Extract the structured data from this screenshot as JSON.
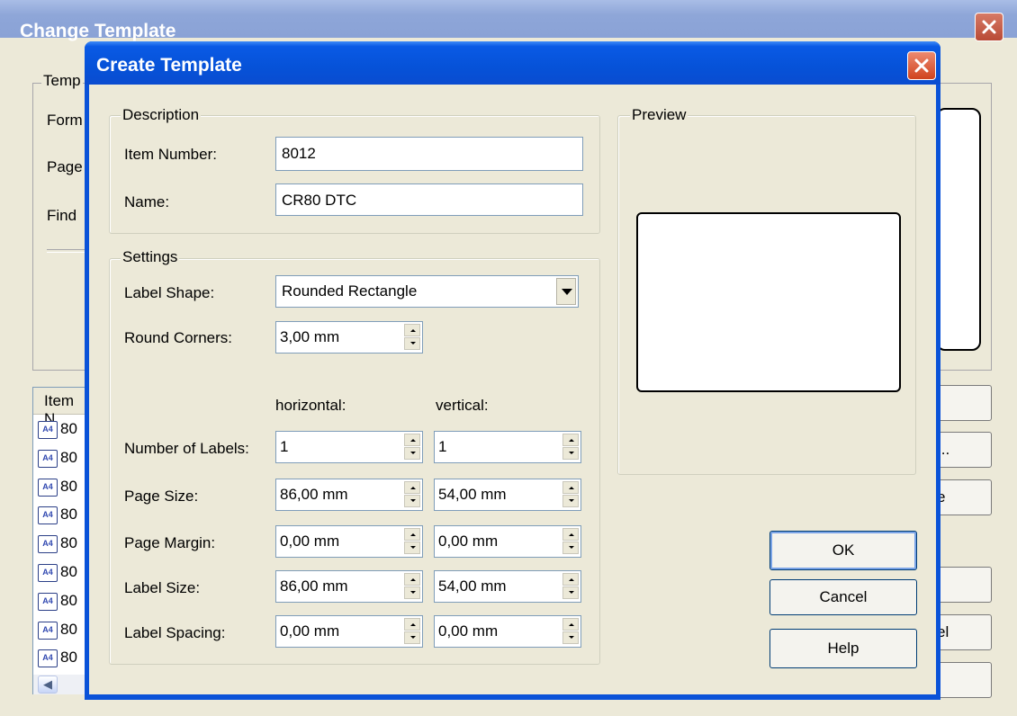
{
  "back_window": {
    "title": "Change Template",
    "group_caption": "Temp",
    "labels": [
      "Form",
      "Page",
      "Find"
    ],
    "list_header": "Item N",
    "list_rows": [
      {
        "icon": "A4",
        "text": "80"
      },
      {
        "icon": "A4",
        "text": "80"
      },
      {
        "icon": "A4",
        "text": "80"
      },
      {
        "icon": "A4",
        "text": "80"
      },
      {
        "icon": "A4",
        "text": "80"
      },
      {
        "icon": "A4",
        "text": "80"
      },
      {
        "icon": "A4",
        "text": "80"
      },
      {
        "icon": "A4",
        "text": "80"
      },
      {
        "icon": "A4",
        "text": "80"
      }
    ],
    "right_buttons": [
      "",
      "...",
      "e",
      "",
      "el",
      ""
    ]
  },
  "dialog": {
    "title": "Create Template",
    "description": {
      "caption": "Description",
      "item_number_label": "Item Number:",
      "item_number_value": "8012",
      "name_label": "Name:",
      "name_value": "CR80 DTC"
    },
    "settings": {
      "caption": "Settings",
      "label_shape_label": "Label Shape:",
      "label_shape_value": "Rounded Rectangle",
      "round_corners_label": "Round Corners:",
      "round_corners_value": "3,00 mm",
      "col_horizontal": "horizontal:",
      "col_vertical": "vertical:",
      "rows": [
        {
          "label": "Number of Labels:",
          "h": "1",
          "v": "1"
        },
        {
          "label": "Page Size:",
          "h": "86,00 mm",
          "v": "54,00 mm"
        },
        {
          "label": "Page Margin:",
          "h": "0,00 mm",
          "v": "0,00 mm"
        },
        {
          "label": "Label Size:",
          "h": "86,00 mm",
          "v": "54,00 mm"
        },
        {
          "label": "Label Spacing:",
          "h": "0,00 mm",
          "v": "0,00 mm"
        }
      ]
    },
    "preview_caption": "Preview",
    "buttons": {
      "ok": "OK",
      "cancel": "Cancel",
      "help": "Help"
    }
  }
}
